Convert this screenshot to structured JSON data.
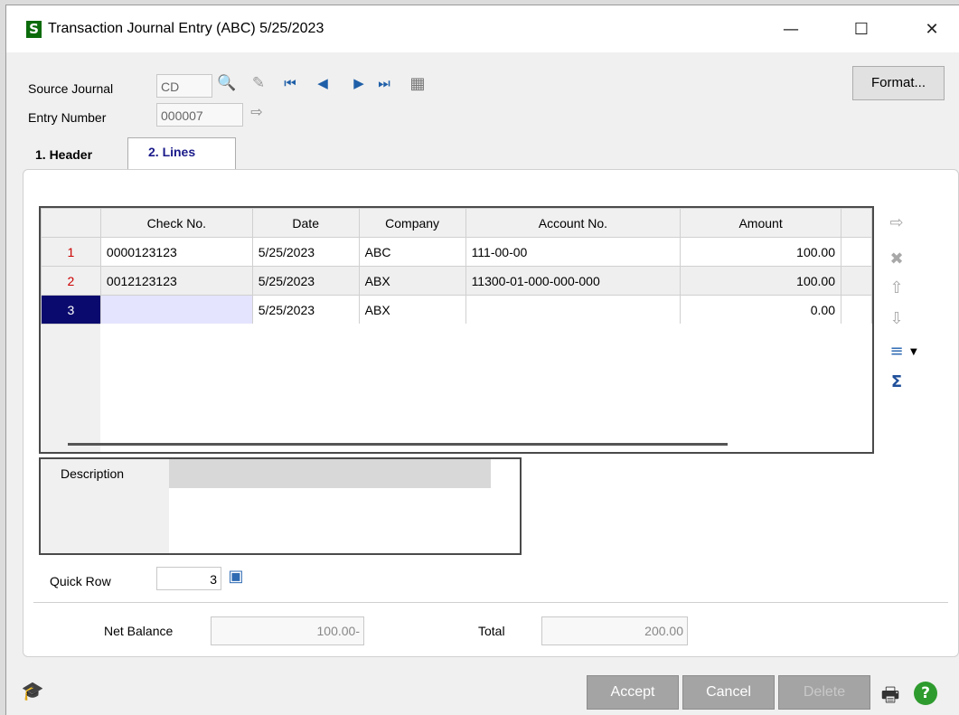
{
  "window": {
    "app_icon_letter": "S",
    "title": "Transaction Journal Entry (ABC) 5/25/2023",
    "minimize_glyph": "—",
    "maximize_glyph": "☐",
    "close_glyph": "✕"
  },
  "header": {
    "source_journal_label": "Source Journal",
    "source_journal_value": "CD",
    "entry_number_label": "Entry Number",
    "entry_number_value": "000007",
    "format_button": "Format..."
  },
  "tabs": [
    {
      "label": "1. Header",
      "active": false
    },
    {
      "label": "2. Lines",
      "active": true
    }
  ],
  "grid": {
    "columns": [
      "Check No.",
      "Date",
      "Company",
      "Account No.",
      "Amount"
    ],
    "rows": [
      {
        "row": "1",
        "check_no": "0000123123",
        "date": "5/25/2023",
        "company": "ABC",
        "account_no": "111-00-00",
        "amount": "100.00"
      },
      {
        "row": "2",
        "check_no": "0012123123",
        "date": "5/25/2023",
        "company": "ABX",
        "account_no": "11300-01-000-000-000",
        "amount": "100.00"
      },
      {
        "row": "3",
        "check_no": "",
        "date": "5/25/2023",
        "company": "ABX",
        "account_no": "",
        "amount": "0.00"
      }
    ]
  },
  "description": {
    "label": "Description",
    "value": ""
  },
  "quick_row": {
    "label": "Quick Row",
    "value": "3"
  },
  "totals": {
    "net_balance_label": "Net Balance",
    "net_balance_value": "100.00-",
    "total_label": "Total",
    "total_value": "200.00"
  },
  "footer": {
    "accept": "Accept",
    "cancel": "Cancel",
    "delete": "Delete"
  },
  "icons": {
    "search": "🔍",
    "pencil": "✎",
    "first": "⏮",
    "prev": "◀",
    "next": "▶",
    "last": "⏭",
    "calendar": "▦",
    "next_number": "⇨",
    "insert_row": "⇨",
    "delete_row": "✖",
    "move_up": "⇧",
    "move_down": "⇩",
    "customize": "≡",
    "sigma": "Σ",
    "quick_row_icon": "▣",
    "learn": "🎓",
    "print": "🖶",
    "help": "?"
  },
  "colors": {
    "selected_row": "#0a0a6e",
    "row_number": "#cc0000",
    "disabled_button": "#a4a4a4",
    "help_green": "#2e9b2e",
    "app_icon_green": "#0b6b0b"
  }
}
